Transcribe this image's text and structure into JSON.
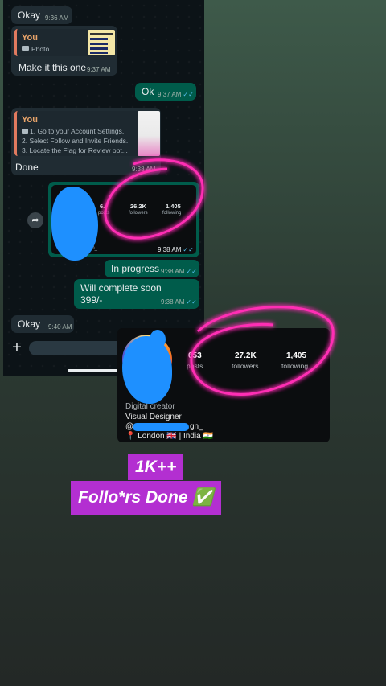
{
  "chat": {
    "msg_okay_top": {
      "text": "Okay",
      "time": "9:36 AM"
    },
    "reply_photo": {
      "quoted_name": "You",
      "quoted_type": "Photo",
      "text": "Make it this one",
      "time": "9:37 AM"
    },
    "msg_ok": {
      "text": "Ok",
      "time": "9:37 AM"
    },
    "reply_steps": {
      "quoted_name": "You",
      "quoted_lines": [
        "1. Go to your Account Settings.",
        "2. Select Follow and Invite Friends.",
        "3. Locate the Flag for Review opt..."
      ],
      "text": "Done",
      "time": "9:38 AM"
    },
    "profile_preview": {
      "posts_num": "6..",
      "posts_label": "posts",
      "followers_num": "26.2K",
      "followers_label": "followers",
      "following_num": "1,405",
      "following_label": "following",
      "name_fragment": "...an_",
      "time": "9:38 AM"
    },
    "msg_progress": {
      "text": "In progress",
      "time": "9:38 AM"
    },
    "msg_complete": {
      "text": "Will complete soon\n399/-",
      "time": "9:38 AM"
    },
    "msg_okay_bottom": {
      "text": "Okay",
      "time": "9:40 AM"
    },
    "add_button_label": "+"
  },
  "profile_card": {
    "posts_num": "653",
    "posts_label": "posts",
    "followers_num": "27.2K",
    "followers_label": "followers",
    "following_num": "1,405",
    "following_label": "following",
    "category": "Digital creator",
    "bio": "Visual Designer",
    "handle_start": "@",
    "handle_end": "gn_",
    "location": "📍 London 🇬🇧 | India 🇮🇳"
  },
  "banner": {
    "line1": "1K++",
    "line2": "Follo*rs Done ✅"
  },
  "colors": {
    "incoming": "#202c33",
    "outgoing": "#005c4b",
    "neon": "#ff2fb4",
    "banner": "#b32fd1",
    "scribble": "#1e90ff"
  },
  "icons": [
    "camera-icon",
    "forward-icon",
    "plus-icon",
    "double-check-icon"
  ]
}
